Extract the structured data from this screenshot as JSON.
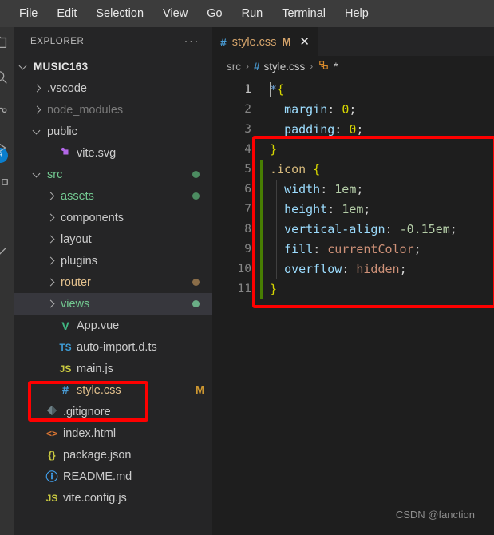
{
  "menubar": {
    "items": [
      {
        "label": "File",
        "mnemonic": "F"
      },
      {
        "label": "Edit",
        "mnemonic": "E"
      },
      {
        "label": "Selection",
        "mnemonic": "S"
      },
      {
        "label": "View",
        "mnemonic": "V"
      },
      {
        "label": "Go",
        "mnemonic": "G"
      },
      {
        "label": "Run",
        "mnemonic": "R"
      },
      {
        "label": "Terminal",
        "mnemonic": "T"
      },
      {
        "label": "Help",
        "mnemonic": "H"
      }
    ]
  },
  "activitybar": {
    "badge": "3",
    "badge_color": "#0a7ece"
  },
  "sidebar": {
    "title": "EXPLORER",
    "more_actions": "···",
    "tree": [
      {
        "label": "MUSIC163",
        "kind": "root",
        "twisty": "open",
        "indent": 0,
        "icon": "",
        "icon_color": "",
        "text_color": "#e6e6e6",
        "dot": "",
        "badge": ""
      },
      {
        "label": ".vscode",
        "kind": "folder",
        "twisty": "closed",
        "indent": 1,
        "icon": "",
        "icon_color": "",
        "text_color": "#cccccc",
        "dot": "",
        "badge": ""
      },
      {
        "label": "node_modules",
        "kind": "folder",
        "twisty": "closed",
        "indent": 1,
        "icon": "",
        "icon_color": "",
        "text_color": "#7a7a7a",
        "dot": "",
        "badge": ""
      },
      {
        "label": "public",
        "kind": "folder",
        "twisty": "open",
        "indent": 1,
        "icon": "",
        "icon_color": "",
        "text_color": "#cccccc",
        "dot": "",
        "badge": ""
      },
      {
        "label": "vite.svg",
        "kind": "file",
        "twisty": "none",
        "indent": 2,
        "icon": "vite-svg-icon",
        "icon_color": "#b267e6",
        "text_color": "#cccccc",
        "dot": "",
        "badge": ""
      },
      {
        "label": "src",
        "kind": "folder",
        "twisty": "open",
        "indent": 1,
        "icon": "",
        "icon_color": "",
        "text_color": "#73c991",
        "dot": "#4c8c61",
        "badge": ""
      },
      {
        "label": "assets",
        "kind": "folder",
        "twisty": "closed",
        "indent": 2,
        "icon": "",
        "icon_color": "",
        "text_color": "#73c991",
        "dot": "#4c8c61",
        "badge": ""
      },
      {
        "label": "components",
        "kind": "folder",
        "twisty": "closed",
        "indent": 2,
        "icon": "",
        "icon_color": "",
        "text_color": "#cccccc",
        "dot": "",
        "badge": ""
      },
      {
        "label": "layout",
        "kind": "folder",
        "twisty": "closed",
        "indent": 2,
        "icon": "",
        "icon_color": "",
        "text_color": "#cccccc",
        "dot": "",
        "badge": ""
      },
      {
        "label": "plugins",
        "kind": "folder",
        "twisty": "closed",
        "indent": 2,
        "icon": "",
        "icon_color": "",
        "text_color": "#cccccc",
        "dot": "",
        "badge": ""
      },
      {
        "label": "router",
        "kind": "folder",
        "twisty": "closed",
        "indent": 2,
        "icon": "",
        "icon_color": "",
        "text_color": "#e2c08d",
        "dot": "#8a6d48",
        "badge": ""
      },
      {
        "label": "views",
        "kind": "folder",
        "twisty": "closed",
        "indent": 2,
        "icon": "",
        "icon_color": "",
        "text_color": "#73c991",
        "dot": "#6aae86",
        "badge": "",
        "selected": true
      },
      {
        "label": "App.vue",
        "kind": "file",
        "twisty": "none",
        "indent": 2,
        "icon": "V",
        "icon_color": "#41b883",
        "text_color": "#cccccc",
        "dot": "",
        "badge": ""
      },
      {
        "label": "auto-import.d.ts",
        "kind": "file",
        "twisty": "none",
        "indent": 2,
        "icon": "TS",
        "icon_color": "#3e9bd4",
        "text_color": "#cccccc",
        "dot": "",
        "badge": ""
      },
      {
        "label": "main.js",
        "kind": "file",
        "twisty": "none",
        "indent": 2,
        "icon": "JS",
        "icon_color": "#cbcb41",
        "text_color": "#cccccc",
        "dot": "",
        "badge": ""
      },
      {
        "label": "style.css",
        "kind": "file",
        "twisty": "none",
        "indent": 2,
        "icon": "#",
        "icon_color": "#4a9ed8",
        "text_color": "#e2c08d",
        "dot": "",
        "badge": "M"
      },
      {
        "label": ".gitignore",
        "kind": "file",
        "twisty": "none",
        "indent": 1,
        "icon": "gitignore-icon",
        "icon_color": "#6d8086",
        "text_color": "#cccccc",
        "dot": "",
        "badge": ""
      },
      {
        "label": "index.html",
        "kind": "file",
        "twisty": "none",
        "indent": 1,
        "icon": "<>",
        "icon_color": "#e37933",
        "text_color": "#cccccc",
        "dot": "",
        "badge": ""
      },
      {
        "label": "package.json",
        "kind": "file",
        "twisty": "none",
        "indent": 1,
        "icon": "{}",
        "icon_color": "#cbcb41",
        "text_color": "#cccccc",
        "dot": "",
        "badge": ""
      },
      {
        "label": "README.md",
        "kind": "file",
        "twisty": "none",
        "indent": 1,
        "icon": "ⓘ",
        "icon_color": "#42a5f5",
        "text_color": "#cccccc",
        "dot": "",
        "badge": ""
      },
      {
        "label": "vite.config.js",
        "kind": "file",
        "twisty": "none",
        "indent": 1,
        "icon": "JS",
        "icon_color": "#cbcb41",
        "text_color": "#cccccc",
        "dot": "",
        "badge": ""
      }
    ]
  },
  "editor": {
    "tab": {
      "icon": "#",
      "filename": "style.css",
      "modified_badge": "M",
      "close": "✕"
    },
    "breadcrumb": {
      "folder": "src",
      "sep": "›",
      "file_icon": "#",
      "file": "style.css",
      "symbol_icon": "css-selector-icon",
      "symbol": "*"
    },
    "gutter_marker_color": "#487e02",
    "line_numbers": [
      "1",
      "2",
      "3",
      "4",
      "5",
      "6",
      "7",
      "8",
      "9",
      "10",
      "11"
    ],
    "lines": [
      {
        "n": "1",
        "tokens": [
          {
            "t": "*",
            "c": "t-star"
          },
          {
            "t": "{",
            "c": "t-brace"
          }
        ]
      },
      {
        "n": "2",
        "tokens": [
          {
            "t": "  ",
            "c": "t-punc"
          },
          {
            "t": "margin",
            "c": "t-prop"
          },
          {
            "t": ": ",
            "c": "t-punc"
          },
          {
            "t": "0",
            "c": "t-brace"
          },
          {
            "t": ";",
            "c": "t-punc"
          }
        ]
      },
      {
        "n": "3",
        "tokens": [
          {
            "t": "  ",
            "c": "t-punc"
          },
          {
            "t": "padding",
            "c": "t-prop"
          },
          {
            "t": ": ",
            "c": "t-punc"
          },
          {
            "t": "0",
            "c": "t-brace"
          },
          {
            "t": ";",
            "c": "t-punc"
          }
        ]
      },
      {
        "n": "4",
        "tokens": [
          {
            "t": "}",
            "c": "t-brace"
          }
        ]
      },
      {
        "n": "5",
        "tokens": [
          {
            "t": ".icon",
            "c": "t-sel"
          },
          {
            "t": " ",
            "c": "t-punc"
          },
          {
            "t": "{",
            "c": "t-brace"
          }
        ]
      },
      {
        "n": "6",
        "tokens": [
          {
            "t": "  ",
            "c": "t-punc"
          },
          {
            "t": "width",
            "c": "t-prop"
          },
          {
            "t": ": ",
            "c": "t-punc"
          },
          {
            "t": "1em",
            "c": "t-num"
          },
          {
            "t": ";",
            "c": "t-punc"
          }
        ]
      },
      {
        "n": "7",
        "tokens": [
          {
            "t": "  ",
            "c": "t-punc"
          },
          {
            "t": "height",
            "c": "t-prop"
          },
          {
            "t": ": ",
            "c": "t-punc"
          },
          {
            "t": "1em",
            "c": "t-num"
          },
          {
            "t": ";",
            "c": "t-punc"
          }
        ]
      },
      {
        "n": "8",
        "tokens": [
          {
            "t": "  ",
            "c": "t-punc"
          },
          {
            "t": "vertical-align",
            "c": "t-prop"
          },
          {
            "t": ": ",
            "c": "t-punc"
          },
          {
            "t": "-0.15em",
            "c": "t-num"
          },
          {
            "t": ";",
            "c": "t-punc"
          }
        ]
      },
      {
        "n": "9",
        "tokens": [
          {
            "t": "  ",
            "c": "t-punc"
          },
          {
            "t": "fill",
            "c": "t-prop"
          },
          {
            "t": ": ",
            "c": "t-punc"
          },
          {
            "t": "currentColor",
            "c": "t-str"
          },
          {
            "t": ";",
            "c": "t-punc"
          }
        ]
      },
      {
        "n": "10",
        "tokens": [
          {
            "t": "  ",
            "c": "t-punc"
          },
          {
            "t": "overflow",
            "c": "t-prop"
          },
          {
            "t": ": ",
            "c": "t-punc"
          },
          {
            "t": "hidden",
            "c": "t-str"
          },
          {
            "t": ";",
            "c": "t-punc"
          }
        ]
      },
      {
        "n": "11",
        "tokens": [
          {
            "t": "}",
            "c": "t-brace"
          }
        ]
      }
    ]
  },
  "annotations": {
    "color": "#fe0000",
    "boxes": [
      "code-icon-rule-box",
      "explorer-style-css-box"
    ]
  },
  "watermark": "CSDN @fanction"
}
